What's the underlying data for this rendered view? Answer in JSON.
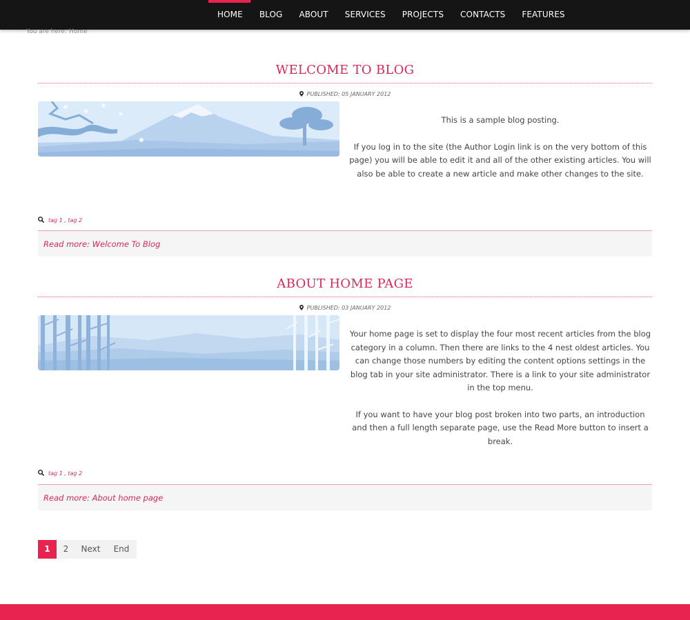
{
  "nav": {
    "items": [
      {
        "label": "HOME",
        "active": true
      },
      {
        "label": "BLOG"
      },
      {
        "label": "ABOUT"
      },
      {
        "label": "SERVICES"
      },
      {
        "label": "PROJECTS"
      },
      {
        "label": "CONTACTS"
      },
      {
        "label": "FEATURES"
      }
    ]
  },
  "breadcrumb": {
    "prefix": "You are here:",
    "current": "Home"
  },
  "articles": [
    {
      "title": "WELCOME TO BLOG",
      "published": "PUBLISHED: 05 JANUARY 2012",
      "paragraphs": [
        "This is a sample blog posting.",
        "If you log in to the site (the Author Login link is on the very bottom of this page) you will be able to edit it and all of the other existing articles. You will also be able to create a new article and make other changes to the site."
      ],
      "tags": [
        "tag 1",
        "tag 2"
      ],
      "readmore": "Read more: Welcome To Blog"
    },
    {
      "title": "ABOUT HOME PAGE",
      "published": "PUBLISHED: 03 JANUARY 2012",
      "paragraphs": [
        "Your home page is set to display the four most recent articles from the blog category in a column. Then there are links to the 4 nest oldest articles. You can change those numbers by editing the content options settings in the blog tab in your site administrator. There is a link to your site administrator in the top menu.",
        "If you want to have your blog post broken into two parts, an introduction and then a full length separate page, use the Read More button to insert a break."
      ],
      "tags": [
        "tag 1",
        "tag 2"
      ],
      "readmore": "Read more: About home page"
    }
  ],
  "pagination": {
    "pages": [
      "1",
      "2"
    ],
    "next": "Next",
    "end": "End",
    "current": "1"
  },
  "colors": {
    "accent": "#e8234f",
    "title": "#d5295a",
    "nav_bg": "#151515"
  }
}
